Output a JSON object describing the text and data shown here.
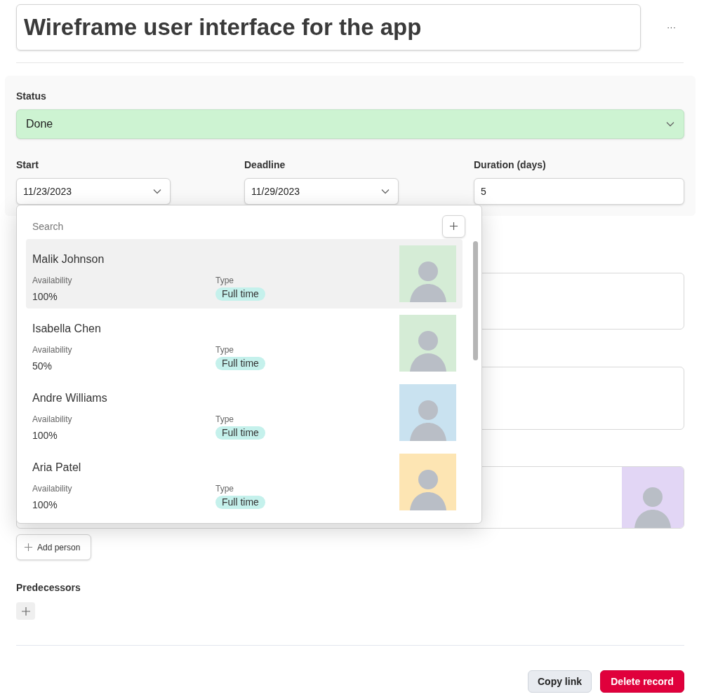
{
  "title": "Wireframe user interface for the app",
  "more_menu": "···",
  "status": {
    "label": "Status",
    "value": "Done"
  },
  "dates": [
    {
      "kind": "select",
      "label": "Start",
      "value": "11/23/2023"
    },
    {
      "kind": "select",
      "label": "Deadline",
      "value": "11/29/2023"
    },
    {
      "kind": "text",
      "label": "Duration (days)",
      "value": "5"
    }
  ],
  "fields_behind": [
    {
      "kind": "text"
    },
    {
      "kind": "text"
    },
    {
      "kind": "person"
    }
  ],
  "add_person": "Add person",
  "predecessors": {
    "label": "Predecessors"
  },
  "buttons": [
    {
      "kind": "secondary",
      "label": "Copy link"
    },
    {
      "kind": "danger",
      "label": "Delete record"
    }
  ],
  "picker": {
    "search": {
      "placeholder": "Search"
    },
    "people": [
      {
        "name": "Malik Johnson",
        "availability_label": "Availability",
        "availability": "100%",
        "type_label": "Type",
        "type": "Full time",
        "selected": true
      },
      {
        "name": "Isabella Chen",
        "availability_label": "Availability",
        "availability": "50%",
        "type_label": "Type",
        "type": "Full time",
        "selected": false
      },
      {
        "name": "Andre Williams",
        "availability_label": "Availability",
        "availability": "100%",
        "type_label": "Type",
        "type": "Full time",
        "selected": false
      },
      {
        "name": "Aria Patel",
        "availability_label": "Availability",
        "availability": "100%",
        "type_label": "Type",
        "type": "Full time",
        "selected": false
      }
    ]
  }
}
